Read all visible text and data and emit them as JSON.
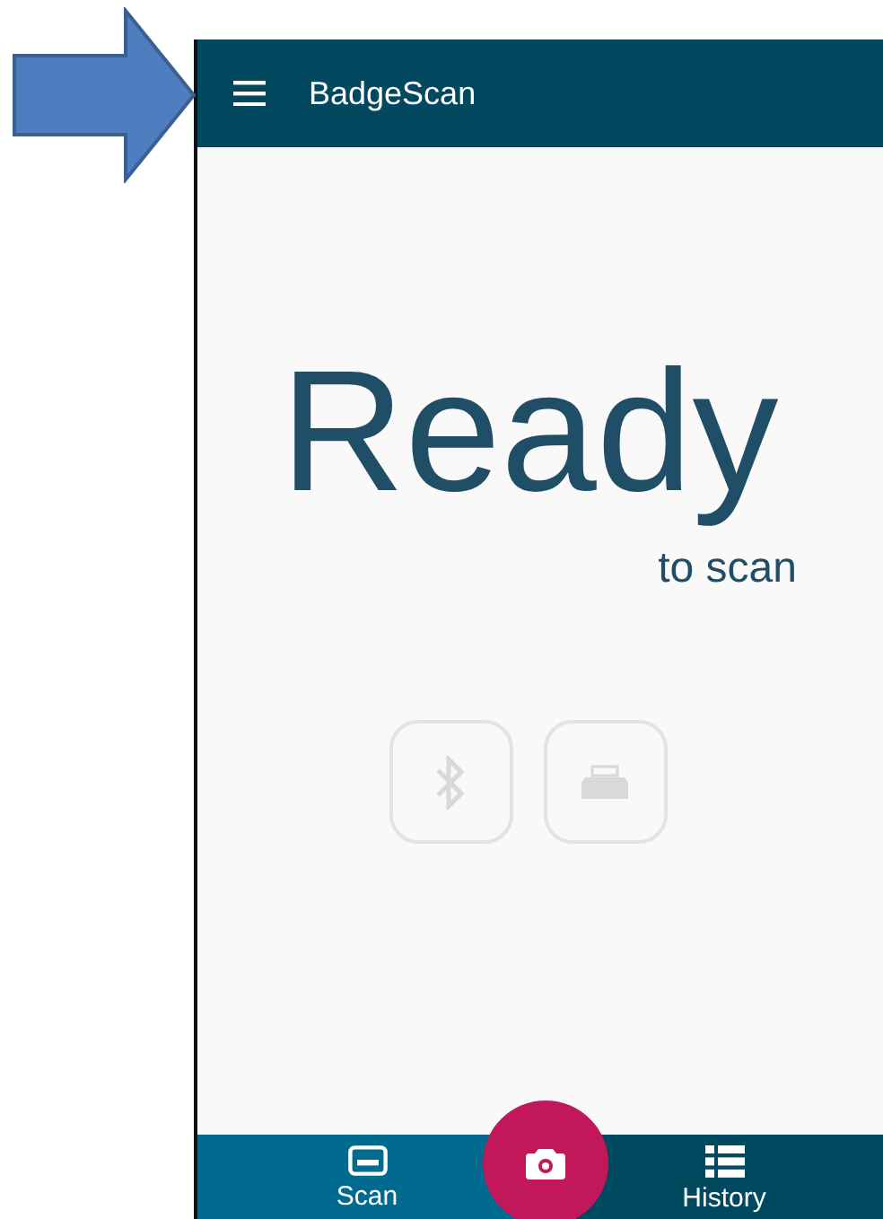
{
  "app_bar": {
    "title": "BadgeScan"
  },
  "status": {
    "headline": "Ready",
    "subline": "to scan"
  },
  "connection_buttons": [
    {
      "kind": "bluetooth",
      "disabled": true
    },
    {
      "kind": "badge-reader",
      "disabled": true
    }
  ],
  "bottom_nav": {
    "tabs": [
      {
        "kind": "card",
        "label": "Scan",
        "selected": true
      },
      {
        "kind": "list",
        "label": "History",
        "selected": false
      }
    ],
    "fab": {
      "kind": "camera"
    }
  },
  "annotation": {
    "kind": "arrow"
  }
}
